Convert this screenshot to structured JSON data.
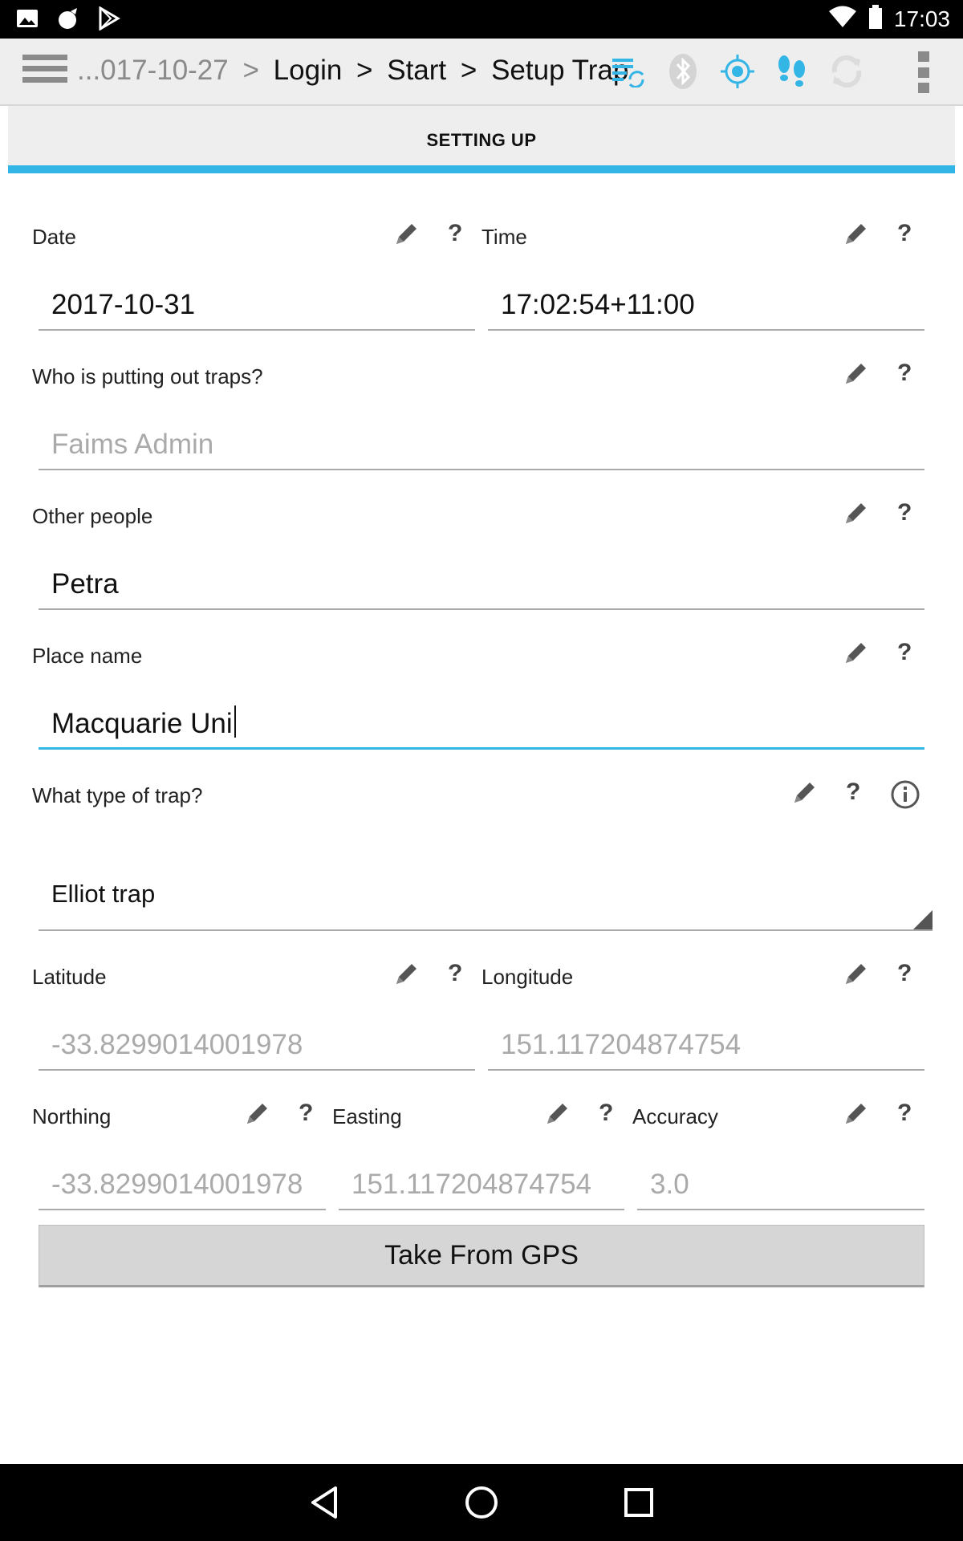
{
  "status_bar": {
    "time": "17:03",
    "left_icons": [
      "image-icon",
      "cat-icon",
      "play-store-icon"
    ],
    "right_icons": [
      "wifi-icon",
      "battery-icon"
    ]
  },
  "action_bar": {
    "breadcrumb": {
      "prefix": "...017-10-27",
      "separator": ">",
      "items": [
        "Login",
        "Start",
        "Setup Trap"
      ]
    },
    "icons": [
      "sync-icon",
      "bluetooth-icon",
      "gps-icon",
      "tracklog-icon",
      "refresh-icon"
    ],
    "accent_color": "#33b5e5"
  },
  "tab": {
    "label": "SETTING UP"
  },
  "form": {
    "date": {
      "label": "Date",
      "value": "2017-10-31"
    },
    "time": {
      "label": "Time",
      "value": "17:02:54+11:00"
    },
    "who": {
      "label": "Who is putting out traps?",
      "value": "Faims Admin"
    },
    "other_people": {
      "label": "Other people",
      "value": "Petra"
    },
    "place_name": {
      "label": "Place name",
      "value": "Macquarie Uni"
    },
    "trap_type": {
      "label": "What type of trap?",
      "value": "Elliot trap"
    },
    "latitude": {
      "label": "Latitude",
      "value": "-33.8299014001978"
    },
    "longitude": {
      "label": "Longitude",
      "value": "151.117204874754"
    },
    "northing": {
      "label": "Northing",
      "value": "-33.8299014001978"
    },
    "easting": {
      "label": "Easting",
      "value": "151.117204874754"
    },
    "accuracy": {
      "label": "Accuracy",
      "value": "3.0"
    },
    "help_glyph": "?",
    "gps_button": "Take From GPS"
  }
}
